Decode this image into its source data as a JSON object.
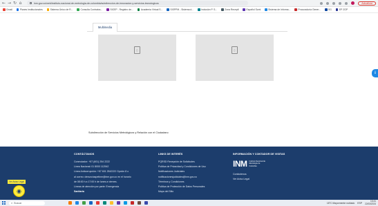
{
  "browser": {
    "url": "inm.gov.co/web/instituto-nacional-de-metrologia-de-colombia/subdireccion-de-innovacion-y-servicios-tecnologicos",
    "update_label": "Actualizar"
  },
  "bookmarks": [
    {
      "label": "Gmail",
      "color": "#ea4335"
    },
    {
      "label": "Planes Institucionales",
      "color": "#1a73e8"
    },
    {
      "label": "Sistema Único de R...",
      "color": "#f9ab00"
    },
    {
      "label": "Consulta Contratos...",
      "color": "#34a853"
    },
    {
      "label": "SIGEP - Registro de...",
      "color": "#7b1fa2"
    },
    {
      "label": "Academia Virtual S...",
      "color": "#0b8043"
    },
    {
      "label": "SISPPM - Sistema d...",
      "color": "#1565c0"
    },
    {
      "label": "Inclusión P. S...",
      "color": "#00838f"
    },
    {
      "label": "Zona Receptl",
      "color": "#455a64"
    },
    {
      "label": "Español Scml",
      "color": "#5e35b1"
    },
    {
      "label": "Sistema de Informa...",
      "color": "#1e88e5"
    },
    {
      "label": "Procuraduría Gener...",
      "color": "#c62828"
    },
    {
      "label": "SG",
      "color": "#0d47a1"
    },
    {
      "label": "EP ZGP",
      "color": "#283593"
    }
  ],
  "tabs": [
    {
      "label": "Multimedia"
    }
  ],
  "subdireccion_text": "Subdirección de Servicios Metrológicos y Relación con el Ciudadano",
  "footer": {
    "contact": {
      "title": "CONTÁCTANOS",
      "lines": [
        "Conmutador: +57 (601) 254 2222",
        "Línea Nacional: 01 8000 112542",
        "Línea Anticorrupción: +57 601 2542222 Opción 8 o",
        "al correo: denunciaspetinm@inm.gov.co en el horario",
        "de 08:00 h a 17:00 h de lunes a viernes.",
        "Líneas de atención por parte: Emergencia",
        "Sanitaria"
      ]
    },
    "links": {
      "title": "LINKS DE INTERÉS",
      "lines": [
        "PQRSD Recepción de Solicitudes",
        "Política de Privacidad y Condiciones de Uso",
        "Notificaciones Judiciales",
        "notificacionesjudiciales@inm.gov.co",
        "Términos y Condiciones",
        "Política de Protección de Datos Personales",
        "Mapa del Sitio"
      ]
    },
    "info": {
      "title": "INFORMACIÓN Y CONTADOR DE VISITAS",
      "logo_mark": "INM",
      "logo_sub": "Instituto Nacional de Metrología de Colombia",
      "lines": [
        "Contáctenos",
        "Ver Aviso Legal"
      ]
    }
  },
  "voice": {
    "label": "Ver Aviso Legal",
    "icon": "microphone-icon"
  },
  "right_float": {
    "label": "i"
  },
  "taskbar": {
    "search_placeholder": "Buscar",
    "apps": [
      "#f57c00",
      "#1e88e5",
      "#43a047",
      "#1565c0",
      "#e53935",
      "#00897b",
      "#fbc02d",
      "#5e35b1",
      "#039be5",
      "#c62828",
      "#6d4c41",
      "#3949ab"
    ],
    "weather": "18°C Mayormente nublado",
    "language": "ESP",
    "time": "13:41",
    "date": "22/03/2024"
  },
  "colors": {
    "footer_bg": "#1c3d6c",
    "voice_yellow": "#ffeb3b",
    "accent_blue": "#1e88e5"
  }
}
